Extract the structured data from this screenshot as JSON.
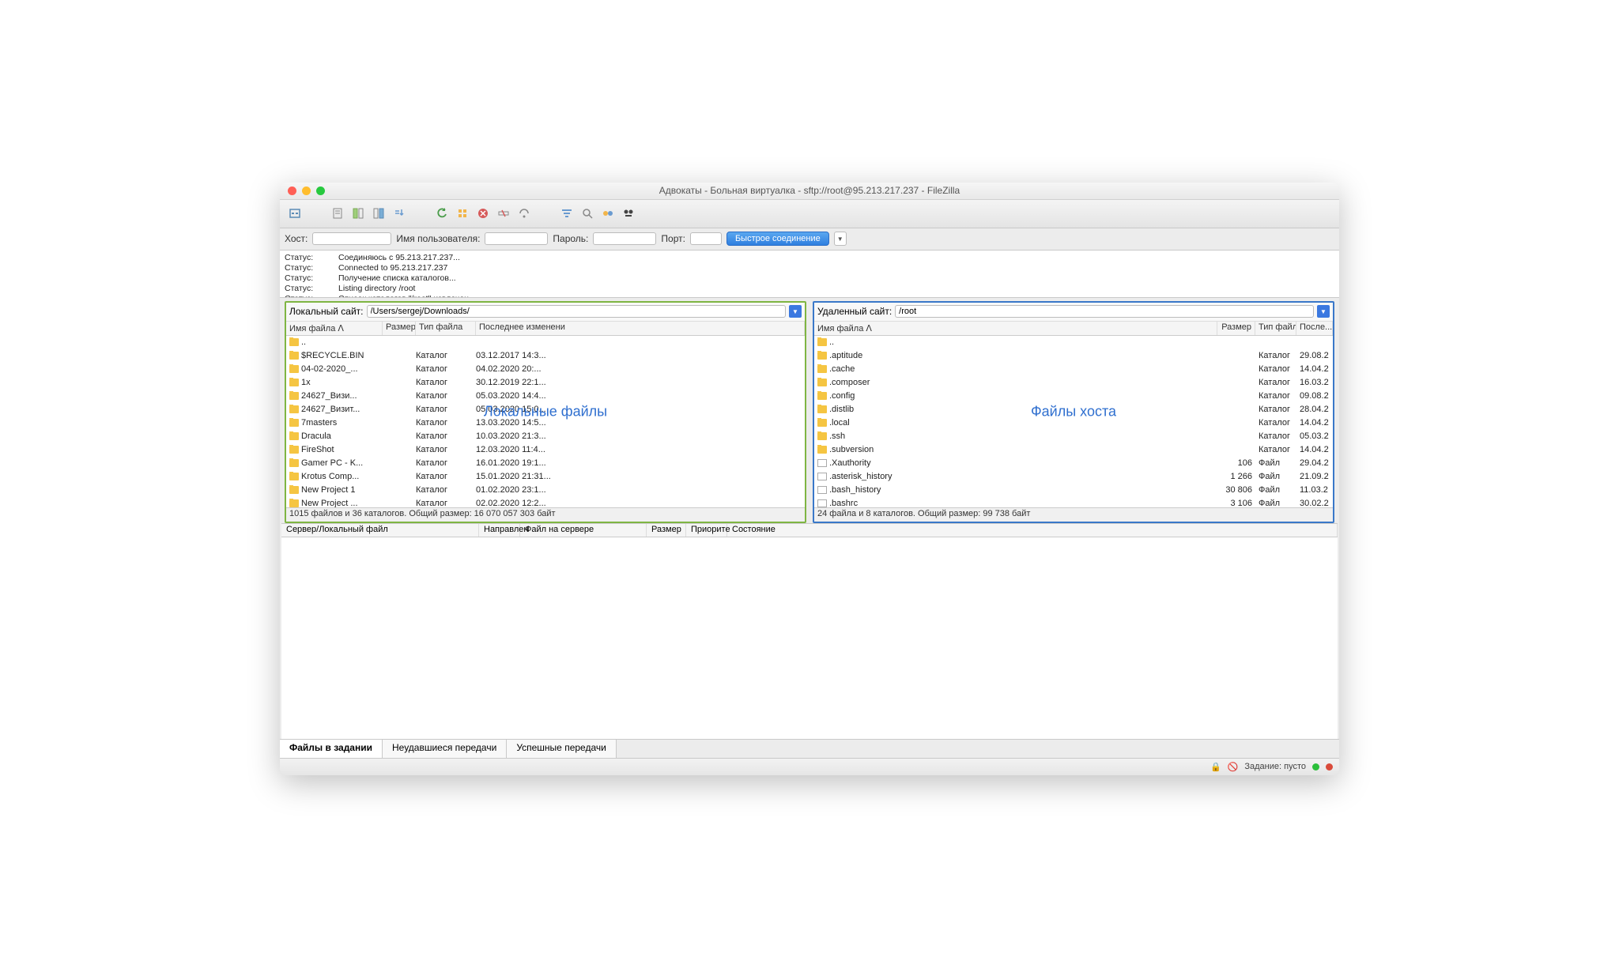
{
  "window_title": "Адвокаты - Больная виртуалка - sftp://root@95.213.217.237 - FileZilla",
  "quickconnect": {
    "host_label": "Хост:",
    "user_label": "Имя пользователя:",
    "pass_label": "Пароль:",
    "port_label": "Порт:",
    "button": "Быстрое соединение",
    "host": "",
    "user": "",
    "pass": "",
    "port": ""
  },
  "log": [
    {
      "lbl": "Статус:",
      "msg": "Соединяюсь с 95.213.217.237..."
    },
    {
      "lbl": "Статус:",
      "msg": "Connected to 95.213.217.237"
    },
    {
      "lbl": "Статус:",
      "msg": "Получение списка каталогов..."
    },
    {
      "lbl": "Статус:",
      "msg": "Listing directory /root"
    },
    {
      "lbl": "Статус:",
      "msg": "Список каталогов \"/root\" извлечен"
    }
  ],
  "local": {
    "label": "Локальный сайт:",
    "path": "/Users/sergej/Downloads/",
    "watermark": "Локальные файлы",
    "headers": {
      "name": "Имя файла ᐱ",
      "size": "Размер",
      "type": "Тип файла",
      "modified": "Последнее изменени"
    },
    "rows": [
      {
        "icon": "folder",
        "name": "..",
        "size": "",
        "type": "",
        "date": ""
      },
      {
        "icon": "folder",
        "name": "$RECYCLE.BIN",
        "size": "",
        "type": "Каталог",
        "date": "03.12.2017 14:3..."
      },
      {
        "icon": "folder",
        "name": "04-02-2020_...",
        "size": "",
        "type": "Каталог",
        "date": "04.02.2020 20:..."
      },
      {
        "icon": "folder",
        "name": "1x",
        "size": "",
        "type": "Каталог",
        "date": "30.12.2019 22:1..."
      },
      {
        "icon": "folder",
        "name": "24627_Визи...",
        "size": "",
        "type": "Каталог",
        "date": "05.03.2020 14:4..."
      },
      {
        "icon": "folder",
        "name": "24627_Визит...",
        "size": "",
        "type": "Каталог",
        "date": "05.03.2020 15:0..."
      },
      {
        "icon": "folder",
        "name": "7masters",
        "size": "",
        "type": "Каталог",
        "date": "13.03.2020 14:5..."
      },
      {
        "icon": "folder",
        "name": "Dracula",
        "size": "",
        "type": "Каталог",
        "date": "10.03.2020 21:3..."
      },
      {
        "icon": "folder",
        "name": "FireShot",
        "size": "",
        "type": "Каталог",
        "date": "12.03.2020 11:4..."
      },
      {
        "icon": "folder",
        "name": "Gamer PC - K...",
        "size": "",
        "type": "Каталог",
        "date": "16.01.2020 19:1..."
      },
      {
        "icon": "folder",
        "name": "Krotus Comp...",
        "size": "",
        "type": "Каталог",
        "date": "15.01.2020 21:31..."
      },
      {
        "icon": "folder",
        "name": "New Project 1",
        "size": "",
        "type": "Каталог",
        "date": "01.02.2020 23:1..."
      },
      {
        "icon": "folder",
        "name": "New Project ...",
        "size": "",
        "type": "Каталог",
        "date": "02.02.2020 12:2..."
      }
    ],
    "status": "1015 файлов и 36 каталогов. Общий размер: 16 070 057 303 байт"
  },
  "remote": {
    "label": "Удаленный сайт:",
    "path": "/root",
    "watermark": "Файлы хоста",
    "headers": {
      "name": "Имя файла ᐱ",
      "size": "Размер",
      "type": "Тип файла",
      "modified": "После..."
    },
    "rows": [
      {
        "icon": "folder",
        "name": "..",
        "size": "",
        "type": "",
        "date": ""
      },
      {
        "icon": "folder",
        "name": ".aptitude",
        "size": "",
        "type": "Каталог",
        "date": "29.08.2"
      },
      {
        "icon": "folder",
        "name": ".cache",
        "size": "",
        "type": "Каталог",
        "date": "14.04.2"
      },
      {
        "icon": "folder",
        "name": ".composer",
        "size": "",
        "type": "Каталог",
        "date": "16.03.2"
      },
      {
        "icon": "folder",
        "name": ".config",
        "size": "",
        "type": "Каталог",
        "date": "09.08.2"
      },
      {
        "icon": "folder",
        "name": ".distlib",
        "size": "",
        "type": "Каталог",
        "date": "28.04.2"
      },
      {
        "icon": "folder",
        "name": ".local",
        "size": "",
        "type": "Каталог",
        "date": "14.04.2"
      },
      {
        "icon": "folder",
        "name": ".ssh",
        "size": "",
        "type": "Каталог",
        "date": "05.03.2"
      },
      {
        "icon": "folder",
        "name": ".subversion",
        "size": "",
        "type": "Каталог",
        "date": "14.04.2"
      },
      {
        "icon": "file",
        "name": ".Xauthority",
        "size": "106",
        "type": "Файл",
        "date": "29.04.2"
      },
      {
        "icon": "file",
        "name": ".asterisk_history",
        "size": "1 266",
        "type": "Файл",
        "date": "21.09.2"
      },
      {
        "icon": "file",
        "name": ".bash_history",
        "size": "30 806",
        "type": "Файл",
        "date": "11.03.2"
      },
      {
        "icon": "file",
        "name": ".bashrc",
        "size": "3 106",
        "type": "Файл",
        "date": "30.02.2"
      }
    ],
    "status": "24 файла и 8 каталогов. Общий размер: 99 738 байт"
  },
  "queue_headers": {
    "server": "Сервер/Локальный файл",
    "direction": "Направлен",
    "remote": "Файл на сервере",
    "size": "Размер",
    "priority": "Приорите",
    "state": "Состояние"
  },
  "tabs": {
    "queued": "Файлы в задании",
    "failed": "Неудавшиеся передачи",
    "success": "Успешные передачи"
  },
  "footer": {
    "queue": "Задание: пусто"
  }
}
